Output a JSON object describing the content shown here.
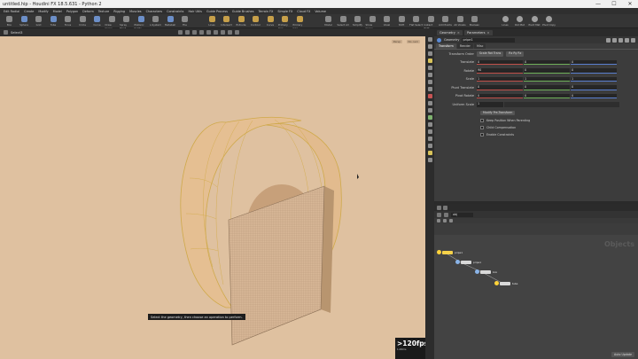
{
  "window": {
    "title": "untitled.hip - Houdini FX 18.5.631 - Python 2",
    "controls": [
      "—",
      "☐",
      "✕"
    ]
  },
  "menu": [
    "Edit Radial",
    "Create",
    "Modify",
    "Model",
    "Polygon",
    "Deform",
    "Texture",
    "Rigging",
    "Muscles",
    "Characters",
    "Constraints",
    "Hair Utils",
    "Guide Process",
    "Guide Brushes",
    "Terrain FX",
    "Simple FX",
    "Cloud FX",
    "Volume"
  ],
  "shelf_left": [
    "Box",
    "Sphere",
    "Grid",
    "Tube",
    "Torus",
    "Circle",
    "Curve",
    "Draw Curve",
    "Spray Paint",
    "Platonic Solids",
    "L-System",
    "Metaball",
    "File"
  ],
  "shelf_mid": [
    "Lines",
    "Intersect",
    "Extrude",
    "Contour",
    "Curve",
    "Primary Geo",
    "Primary Geo"
  ],
  "shelf_right": [
    "Model",
    "Select All",
    "Simplify",
    "Show Curve",
    "Voxel",
    "Shift",
    "Flat Select",
    "Instant Path",
    "Add Points",
    "All Voxels",
    "Boolean"
  ],
  "shelf_far": [
    "Lines",
    "Rot Mat",
    "Pivot Mat",
    "Pivot Copy"
  ],
  "viewport": {
    "tool_label": "Select3",
    "persp": "Persp",
    "cam": "No cam",
    "status": "Select the geometry, then choose an operation to perform.",
    "fps": ">120fps",
    "fps_sub": "1.46ms"
  },
  "panel": {
    "tabs": [
      {
        "label": "Geometry"
      },
      {
        "label": "Parameters"
      }
    ],
    "path_name": "pripe1",
    "node_type": "Geometry",
    "subtabs": [
      "Transform",
      "Render",
      "Misc"
    ],
    "transform_order_label": "Transform Order",
    "transform_order": "Scale Rot Trans",
    "rot_order": "Rx Ry Rz",
    "params": [
      {
        "label": "Translate",
        "x": "0",
        "y": "0",
        "z": "0"
      },
      {
        "label": "Rotate",
        "x": "90",
        "y": "0",
        "z": "0"
      },
      {
        "label": "Scale",
        "x": "1",
        "y": "1",
        "z": "1"
      },
      {
        "label": "Pivot Translate",
        "x": "0",
        "y": "0",
        "z": "0"
      },
      {
        "label": "Pivot Rotate",
        "x": "0",
        "y": "0",
        "z": "0"
      }
    ],
    "uniform_scale_label": "Uniform Scale",
    "uniform_scale": "1",
    "modify_btn": "Modify Pre-Transform",
    "checkboxes": [
      "Keep Position When Parenting",
      "Child Compensation",
      "Enable Constraints"
    ]
  },
  "network": {
    "path": "obj",
    "watermark": "Objects",
    "nodes": [
      "pripe1",
      "pripe1",
      "box",
      "tube"
    ],
    "auto_update": "Auto Update"
  }
}
